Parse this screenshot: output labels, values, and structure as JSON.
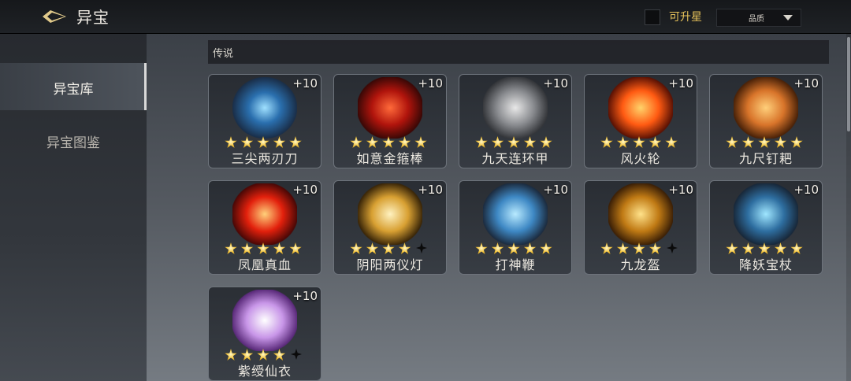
{
  "header": {
    "title": "异宝",
    "upgradeable_label": "可升星",
    "quality_label": "品质"
  },
  "sidebar": {
    "items": [
      {
        "label": "异宝库",
        "active": true
      },
      {
        "label": "异宝图鉴",
        "active": false
      }
    ]
  },
  "section": {
    "label": "传说"
  },
  "items": [
    {
      "name": "三尖两刃刀",
      "level": "+10",
      "stars": 5,
      "half_star": false,
      "icon": "trident-blade-icon"
    },
    {
      "name": "如意金箍棒",
      "level": "+10",
      "stars": 5,
      "half_star": false,
      "icon": "golden-staff-icon"
    },
    {
      "name": "九天连环甲",
      "level": "+10",
      "stars": 5,
      "half_star": false,
      "icon": "armor-icon"
    },
    {
      "name": "风火轮",
      "level": "+10",
      "stars": 5,
      "half_star": false,
      "icon": "fire-wheels-icon"
    },
    {
      "name": "九尺钉耙",
      "level": "+10",
      "stars": 5,
      "half_star": false,
      "icon": "rake-icon"
    },
    {
      "name": "凤凰真血",
      "level": "+10",
      "stars": 5,
      "half_star": false,
      "icon": "phoenix-blood-icon"
    },
    {
      "name": "阴阳两仪灯",
      "level": "+10",
      "stars": 4,
      "half_star": true,
      "icon": "yinyang-lamp-icon"
    },
    {
      "name": "打神鞭",
      "level": "+10",
      "stars": 5,
      "half_star": false,
      "icon": "divine-whip-icon"
    },
    {
      "name": "九龙盔",
      "level": "+10",
      "stars": 4,
      "half_star": true,
      "icon": "dragon-helmet-icon"
    },
    {
      "name": "降妖宝杖",
      "level": "+10",
      "stars": 5,
      "half_star": false,
      "icon": "demon-staff-icon"
    },
    {
      "name": "紫绶仙衣",
      "level": "+10",
      "stars": 4,
      "half_star": true,
      "icon": "immortal-robe-icon"
    }
  ]
}
